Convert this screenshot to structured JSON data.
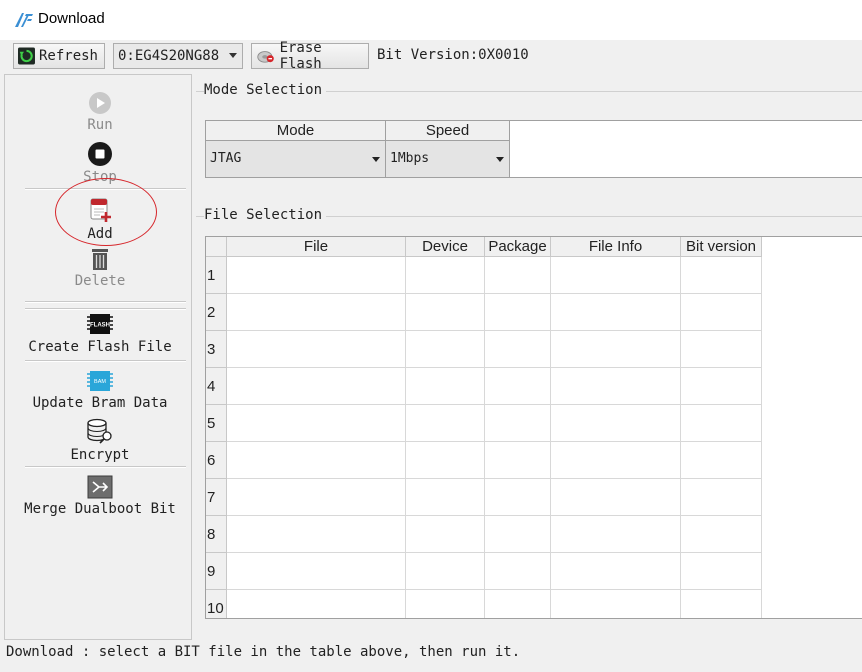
{
  "window": {
    "title": "Download"
  },
  "toolbar": {
    "refresh_label": "Refresh",
    "device_value": "0:EG4S20NG88",
    "erase_flash_label": "Erase Flash",
    "bit_version": "Bit Version:0X0010"
  },
  "sidebar": {
    "run": "Run",
    "stop": "Stop",
    "add": "Add",
    "delete": "Delete",
    "create_flash_file": "Create Flash File",
    "flash_icon_text": "FLASH",
    "update_bram_data": "Update Bram Data",
    "bram_icon_text": "BAM",
    "encrypt": "Encrypt",
    "merge_dualboot_bit": "Merge Dualboot Bit"
  },
  "mode_selection": {
    "title": "Mode Selection",
    "columns": [
      "Mode",
      "Speed"
    ],
    "mode_value": "JTAG",
    "speed_value": "1Mbps"
  },
  "file_selection": {
    "title": "File Selection",
    "columns": [
      "File",
      "Device",
      "Package",
      "File Info",
      "Bit version"
    ],
    "rows": [
      "1",
      "2",
      "3",
      "4",
      "5",
      "6",
      "7",
      "8",
      "9",
      "10"
    ]
  },
  "status": "Download : select a BIT file in the table above, then run it.",
  "colors": {
    "annotation": "#d6262b",
    "add_icon": "#c0282e",
    "logo": "#3b8fd4"
  }
}
